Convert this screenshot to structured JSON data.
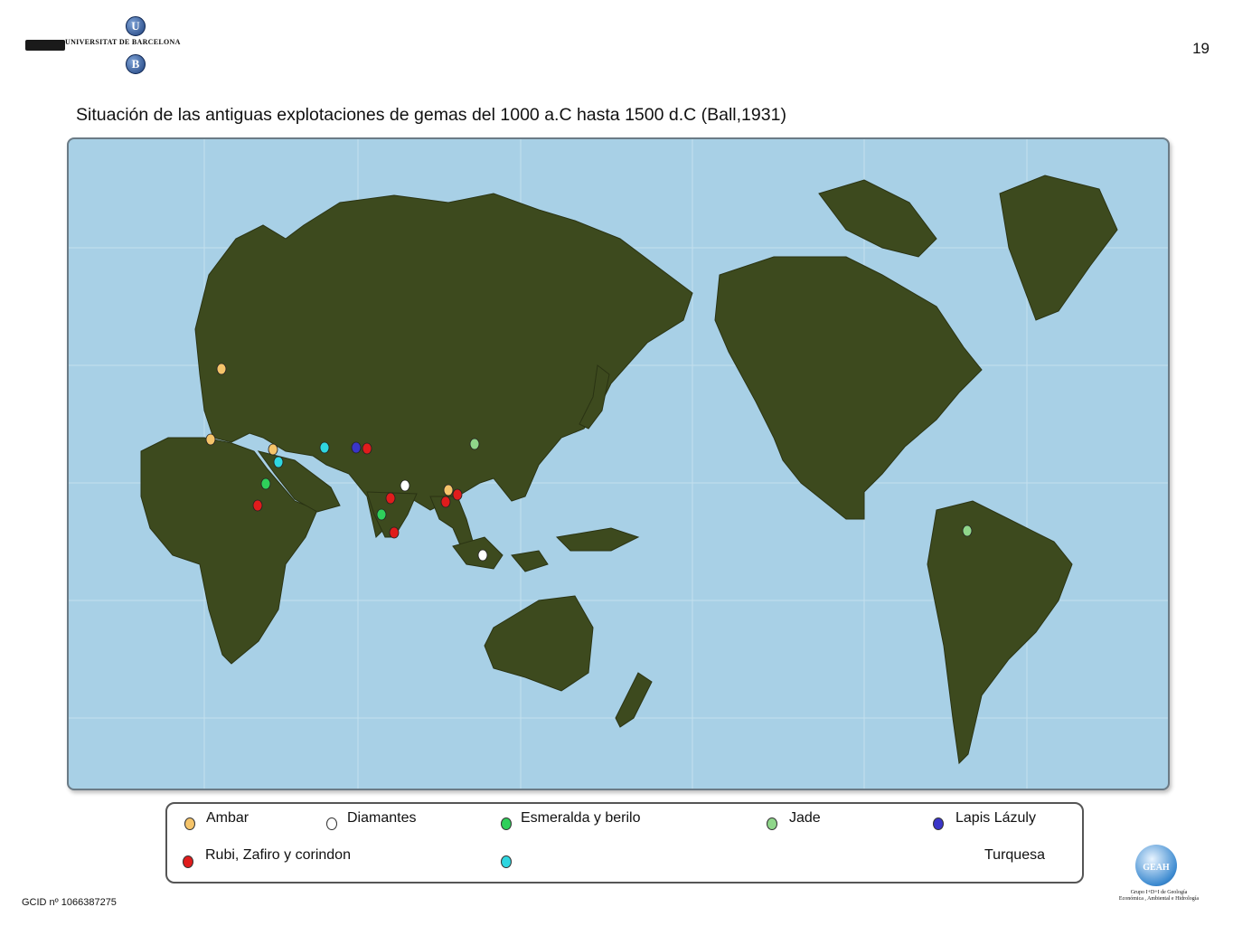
{
  "header": {
    "university": "UNIVERSITAT DE BARCELONA",
    "logo_letters": [
      "U",
      "B"
    ],
    "page_number": "19"
  },
  "title": "Situación de las antiguas explotaciones de gemas del 1000 a.C hasta 1500 d.C (Ball,1931)",
  "map": {
    "ocean_color": "#a8d0e6",
    "land_color": "#3d4a1e",
    "sites": [
      {
        "type": "Ambar",
        "region": "Baltic"
      },
      {
        "type": "Ambar",
        "region": "Italy"
      },
      {
        "type": "Ambar",
        "region": "Levant"
      },
      {
        "type": "Ambar",
        "region": "Burma"
      },
      {
        "type": "Diamantes",
        "region": "India"
      },
      {
        "type": "Diamantes",
        "region": "Borneo"
      },
      {
        "type": "Esmeralda y berilo",
        "region": "Egypt"
      },
      {
        "type": "Esmeralda y berilo",
        "region": "India"
      },
      {
        "type": "Jade",
        "region": "China"
      },
      {
        "type": "Jade",
        "region": "Colombia"
      },
      {
        "type": "Lapis Lázuly",
        "region": "Afghanistan"
      },
      {
        "type": "Rubi, Zafiro y corindon",
        "region": "Sudan"
      },
      {
        "type": "Rubi, Zafiro y corindon",
        "region": "Afghanistan"
      },
      {
        "type": "Rubi, Zafiro y corindon",
        "region": "India"
      },
      {
        "type": "Rubi, Zafiro y corindon",
        "region": "Sri Lanka"
      },
      {
        "type": "Rubi, Zafiro y corindon",
        "region": "Burma"
      },
      {
        "type": "Rubi, Zafiro y corindon",
        "region": "Thailand"
      },
      {
        "type": "Turquesa",
        "region": "Sinai"
      },
      {
        "type": "Turquesa",
        "region": "Persia"
      }
    ]
  },
  "legend": {
    "items": [
      {
        "label": "Ambar",
        "color": "#f5c46a"
      },
      {
        "label": "Diamantes",
        "color": "#ffffff"
      },
      {
        "label": "Esmeralda y berilo",
        "color": "#2fcf5a"
      },
      {
        "label": "Jade",
        "color": "#8fd68a"
      },
      {
        "label": "Lapis Lázuly",
        "color": "#3a35c8"
      },
      {
        "label": "Rubi, Zafiro y corindon",
        "color": "#e01c1c"
      },
      {
        "label": "Turquesa",
        "color": "#2fd6e0"
      }
    ]
  },
  "footer": {
    "id": "GCID nº 1066387275",
    "group_logo": "GEAH",
    "group_caption_1": "Grupo I+D+I de Geología",
    "group_caption_2": "Económica , Ambiental e Hidrología"
  }
}
